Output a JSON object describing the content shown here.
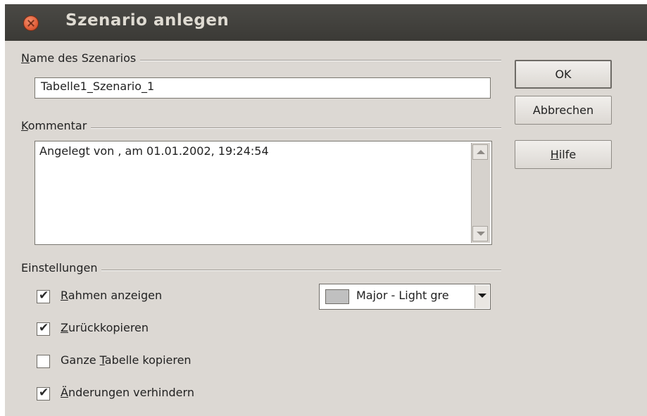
{
  "window": {
    "title": "Szenario anlegen"
  },
  "name_section": {
    "label_mnemonic": "N",
    "label_rest": "ame des Szenarios",
    "value": "Tabelle1_Szenario_1"
  },
  "comment_section": {
    "label_mnemonic": "K",
    "label_rest": "ommentar",
    "value": "Angelegt von  , am 01.01.2002, 19:24:54"
  },
  "settings_section": {
    "label": "Einstellungen",
    "options": [
      {
        "before": "",
        "mnemonic": "R",
        "after": "ahmen anzeigen",
        "checked": true
      },
      {
        "before": "",
        "mnemonic": "Z",
        "after": "urückkopieren",
        "checked": true
      },
      {
        "before": "Ganze ",
        "mnemonic": "T",
        "after": "abelle kopieren",
        "checked": false
      },
      {
        "before": "",
        "mnemonic": "Ä",
        "after": "nderungen verhindern",
        "checked": true
      }
    ],
    "color_select": {
      "value": "Major - Light gre",
      "swatch_color": "#c0c0c0"
    }
  },
  "buttons": {
    "ok": "OK",
    "cancel": "Abbrechen",
    "help_mnemonic": "H",
    "help_rest": "ilfe"
  },
  "check_mark": "✔"
}
